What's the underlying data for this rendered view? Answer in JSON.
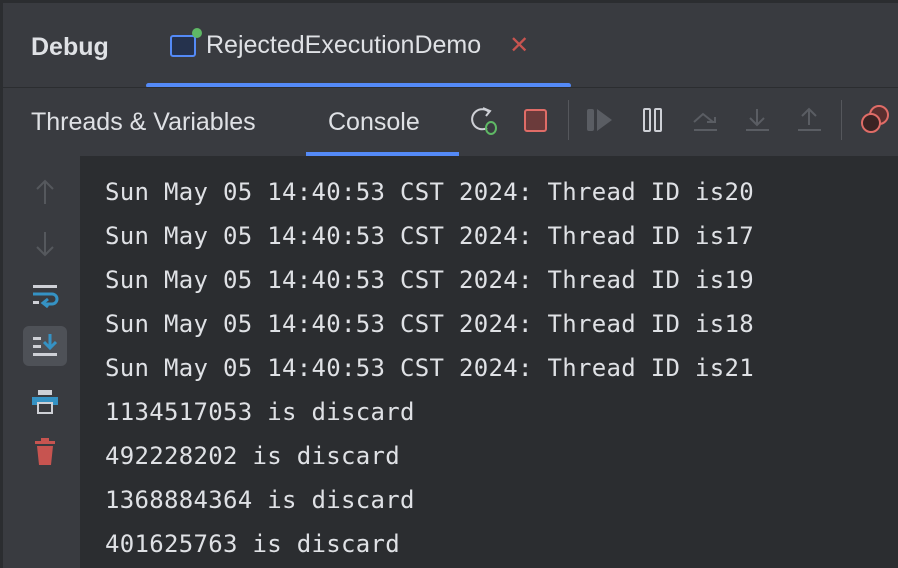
{
  "header": {
    "title": "Debug",
    "tab": {
      "label": "RejectedExecutionDemo",
      "icon": "application-icon",
      "close_icon": "close-icon"
    }
  },
  "toolbar": {
    "tabs": [
      {
        "label": "Threads & Variables"
      },
      {
        "label": "Console",
        "active": true
      }
    ],
    "icons": [
      "rerun-debug-icon",
      "stop-icon",
      "resume-icon",
      "pause-icon",
      "step-over-icon",
      "step-into-icon",
      "step-out-icon",
      "view-breakpoints-icon"
    ]
  },
  "gutter": {
    "icons": [
      "up-arrow-icon",
      "down-arrow-icon",
      "soft-wrap-icon",
      "scroll-to-end-icon",
      "print-icon",
      "clear-all-icon"
    ]
  },
  "console": {
    "lines": [
      "Sun May 05 14:40:53 CST 2024: Thread ID is20",
      "Sun May 05 14:40:53 CST 2024: Thread ID is17",
      "Sun May 05 14:40:53 CST 2024: Thread ID is19",
      "Sun May 05 14:40:53 CST 2024: Thread ID is18",
      "Sun May 05 14:40:53 CST 2024: Thread ID is21",
      "1134517053 is discard",
      "492228202 is discard",
      "1368884364 is discard",
      "401625763 is discard"
    ]
  },
  "colors": {
    "accent": "#548af7",
    "stop": "#c75450",
    "debug_green": "#5fb865"
  }
}
